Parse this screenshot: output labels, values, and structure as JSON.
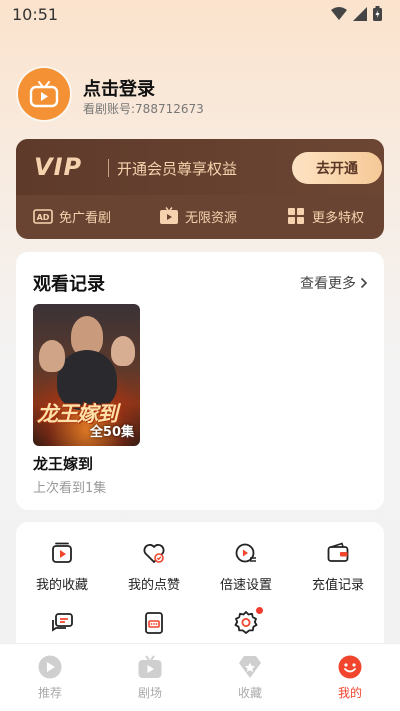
{
  "status": {
    "time": "10:51"
  },
  "profile": {
    "title": "点击登录",
    "account": "看剧账号:788712673"
  },
  "vip": {
    "logo": "VIP",
    "slogan": "开通会员尊享权益",
    "button": "去开通",
    "features": [
      {
        "icon": "ad-icon",
        "label": "免广看剧"
      },
      {
        "icon": "play-icon",
        "label": "无限资源"
      },
      {
        "icon": "grid-icon",
        "label": "更多特权"
      }
    ]
  },
  "history": {
    "title": "观看记录",
    "more": "查看更多",
    "items": [
      {
        "name": "龙王嫁到",
        "progress": "上次看到1集",
        "episodes": "全50集",
        "poster_text": "龙王嫁到"
      }
    ]
  },
  "functions": [
    {
      "icon": "favorites-icon",
      "label": "我的收藏"
    },
    {
      "icon": "likes-icon",
      "label": "我的点赞"
    },
    {
      "icon": "speed-icon",
      "label": "倍速设置"
    },
    {
      "icon": "wallet-icon",
      "label": "充值记录"
    },
    {
      "icon": "message-icon",
      "label": ""
    },
    {
      "icon": "feedback-icon",
      "label": ""
    },
    {
      "icon": "settings-icon",
      "label": "",
      "badge": true
    }
  ],
  "nav": [
    {
      "icon": "recommend-icon",
      "label": "推荐",
      "active": false
    },
    {
      "icon": "theater-icon",
      "label": "剧场",
      "active": false
    },
    {
      "icon": "collect-icon",
      "label": "收藏",
      "active": false
    },
    {
      "icon": "profile-icon",
      "label": "我的",
      "active": true
    }
  ],
  "colors": {
    "accent": "#f2452d",
    "vip_bg": "#6a4433",
    "vip_gold": "#f6d3ae",
    "avatar": "#f49135"
  }
}
